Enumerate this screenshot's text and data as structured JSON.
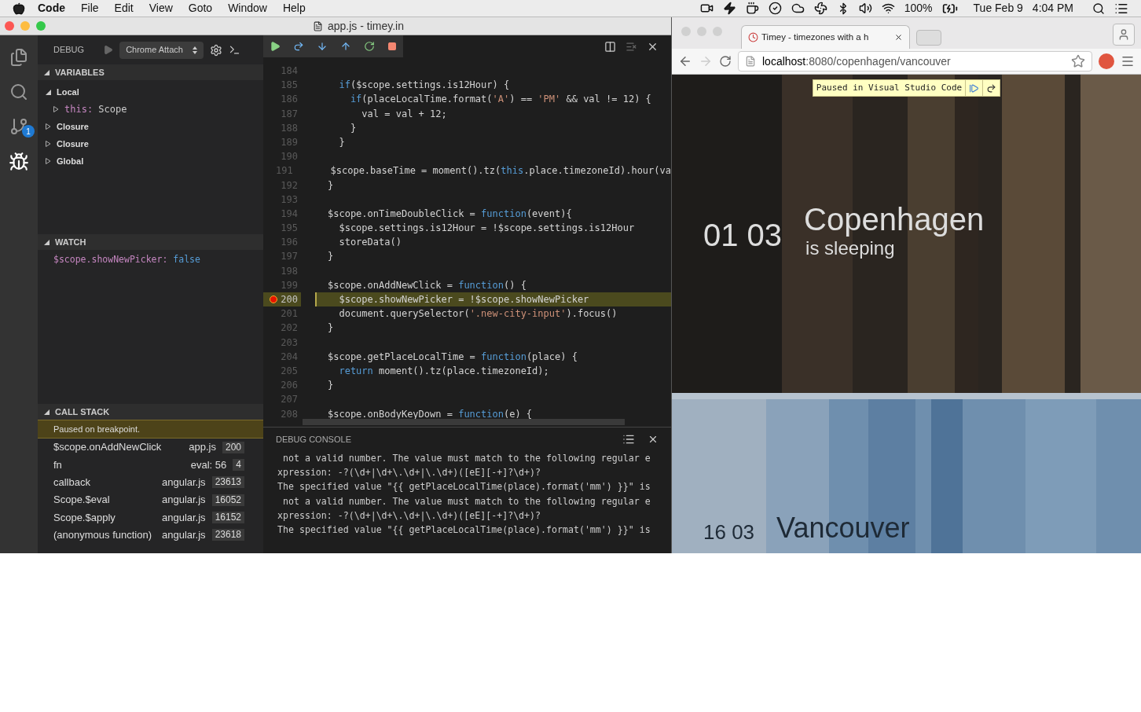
{
  "menubar": {
    "app": "Code",
    "menus": [
      "File",
      "Edit",
      "View",
      "Goto",
      "Window",
      "Help"
    ],
    "battery": "100%",
    "date": "Tue Feb 9",
    "time": "4:04 PM"
  },
  "editor_window": {
    "title": "app.js - timey.in",
    "activity_badge": "1",
    "debug_header": {
      "label": "DEBUG",
      "configuration": "Chrome Attach"
    },
    "variables": {
      "title": "VARIABLES",
      "expanded": true,
      "items": [
        {
          "label": "Local",
          "expanded": true,
          "children": [
            {
              "name": "this:",
              "value": "Scope",
              "expanded": false
            }
          ]
        },
        {
          "label": "Closure",
          "expanded": false
        },
        {
          "label": "Closure",
          "expanded": false
        },
        {
          "label": "Global",
          "expanded": false
        }
      ]
    },
    "watch": {
      "title": "WATCH",
      "expanded": true,
      "items": [
        {
          "expression": "$scope.showNewPicker:",
          "value": "false"
        }
      ]
    },
    "call_stack": {
      "title": "CALL STACK",
      "expanded": true,
      "status": "Paused on breakpoint.",
      "frames": [
        {
          "name": "$scope.onAddNewClick",
          "source": "app.js",
          "line": "200"
        },
        {
          "name": "fn",
          "source": "eval: 56",
          "line": "4"
        },
        {
          "name": "callback",
          "source": "angular.js",
          "line": "23613"
        },
        {
          "name": "Scope.$eval",
          "source": "angular.js",
          "line": "16052"
        },
        {
          "name": "Scope.$apply",
          "source": "angular.js",
          "line": "16152"
        },
        {
          "name": "(anonymous function)",
          "source": "angular.js",
          "line": "23618"
        }
      ]
    },
    "code": {
      "lines": [
        {
          "number": "184",
          "current": false,
          "breakpoint": false
        },
        {
          "number": "185",
          "current": false,
          "breakpoint": false,
          "tokens": [
            {
              "text": "  if",
              "kind": "keyword"
            },
            {
              "text": "($scope.settings.is12Hour) {",
              "kind": "plain"
            }
          ]
        },
        {
          "number": "186",
          "current": false,
          "breakpoint": false,
          "tokens": [
            {
              "text": "    if",
              "kind": "keyword"
            },
            {
              "text": "(placeLocalTime.format(",
              "kind": "plain"
            },
            {
              "text": "'A'",
              "kind": "string"
            },
            {
              "text": ") == ",
              "kind": "plain"
            },
            {
              "text": "'PM'",
              "kind": "string"
            },
            {
              "text": " && val != 12) {",
              "kind": "plain"
            }
          ]
        },
        {
          "number": "187",
          "current": false,
          "breakpoint": false,
          "tokens": [
            {
              "text": "      val = val + 12;",
              "kind": "plain"
            }
          ]
        },
        {
          "number": "188",
          "current": false,
          "breakpoint": false,
          "tokens": [
            {
              "text": "    }",
              "kind": "plain"
            }
          ]
        },
        {
          "number": "189",
          "current": false,
          "breakpoint": false,
          "tokens": [
            {
              "text": "  }",
              "kind": "plain"
            }
          ]
        },
        {
          "number": "190",
          "current": false,
          "breakpoint": false
        },
        {
          "number": "191",
          "current": false,
          "breakpoint": false,
          "tokens": [
            {
              "text": "  $scope.baseTime = moment().tz(",
              "kind": "plain"
            },
            {
              "text": "this",
              "kind": "keyword"
            },
            {
              "text": ".place.timezoneId).hour(va",
              "kind": "plain"
            }
          ]
        },
        {
          "number": "192",
          "current": false,
          "breakpoint": false,
          "tokens": [
            {
              "text": "}",
              "kind": "plain"
            }
          ]
        },
        {
          "number": "193",
          "current": false,
          "breakpoint": false
        },
        {
          "number": "194",
          "current": false,
          "breakpoint": false,
          "tokens": [
            {
              "text": "$scope.onTimeDoubleClick = ",
              "kind": "plain"
            },
            {
              "text": "function",
              "kind": "keyword"
            },
            {
              "text": "(event){",
              "kind": "plain"
            }
          ]
        },
        {
          "number": "195",
          "current": false,
          "breakpoint": false,
          "tokens": [
            {
              "text": "  $scope.settings.is12Hour = !$scope.settings.is12Hour",
              "kind": "plain"
            }
          ]
        },
        {
          "number": "196",
          "current": false,
          "breakpoint": false,
          "tokens": [
            {
              "text": "  storeData()",
              "kind": "plain"
            }
          ]
        },
        {
          "number": "197",
          "current": false,
          "breakpoint": false,
          "tokens": [
            {
              "text": "}",
              "kind": "plain"
            }
          ]
        },
        {
          "number": "198",
          "current": false,
          "breakpoint": false
        },
        {
          "number": "199",
          "current": false,
          "breakpoint": false,
          "tokens": [
            {
              "text": "$scope.onAddNewClick = ",
              "kind": "plain"
            },
            {
              "text": "function",
              "kind": "keyword"
            },
            {
              "text": "() {",
              "kind": "plain"
            }
          ]
        },
        {
          "number": "200",
          "current": true,
          "breakpoint": true,
          "tokens": [
            {
              "text": "  $scope.showNewPicker = !$scope.showNewPicker",
              "kind": "plain"
            }
          ]
        },
        {
          "number": "201",
          "current": false,
          "breakpoint": false,
          "tokens": [
            {
              "text": "  document.querySelector(",
              "kind": "plain"
            },
            {
              "text": "'.new-city-input'",
              "kind": "string"
            },
            {
              "text": ").focus()",
              "kind": "plain"
            }
          ]
        },
        {
          "number": "202",
          "current": false,
          "breakpoint": false,
          "tokens": [
            {
              "text": "}",
              "kind": "plain"
            }
          ]
        },
        {
          "number": "203",
          "current": false,
          "breakpoint": false
        },
        {
          "number": "204",
          "current": false,
          "breakpoint": false,
          "tokens": [
            {
              "text": "$scope.getPlaceLocalTime = ",
              "kind": "plain"
            },
            {
              "text": "function",
              "kind": "keyword"
            },
            {
              "text": "(place) {",
              "kind": "plain"
            }
          ]
        },
        {
          "number": "205",
          "current": false,
          "breakpoint": false,
          "tokens": [
            {
              "text": "  return",
              "kind": "keyword"
            },
            {
              "text": " moment().tz(place.timezoneId);",
              "kind": "plain"
            }
          ]
        },
        {
          "number": "206",
          "current": false,
          "breakpoint": false,
          "tokens": [
            {
              "text": "}",
              "kind": "plain"
            }
          ]
        },
        {
          "number": "207",
          "current": false,
          "breakpoint": false
        },
        {
          "number": "208",
          "current": false,
          "breakpoint": false,
          "tokens": [
            {
              "text": "$scope.onBodyKeyDown = ",
              "kind": "plain"
            },
            {
              "text": "function",
              "kind": "keyword"
            },
            {
              "text": "(e) {",
              "kind": "plain"
            }
          ]
        }
      ]
    },
    "debug_console": {
      "title": "DEBUG CONSOLE",
      "lines": [
        " not a valid number. The value must match to the following regular e",
        "xpression: -?(\\d+|\\d+\\.\\d+|\\.\\d+)([eE][-+]?\\d+)?",
        "The specified value \"{{ getPlaceLocalTime(place).format('mm') }}\" is",
        " not a valid number. The value must match to the following regular e",
        "xpression: -?(\\d+|\\d+\\.\\d+|\\.\\d+)([eE][-+]?\\d+)?",
        "The specified value \"{{ getPlaceLocalTime(place).format('mm') }}\" is"
      ]
    }
  },
  "browser": {
    "tab": {
      "title": "Timey - timezones with a h"
    },
    "address": {
      "host": "localhost",
      "path": ":8080/copenhagen/vancouver"
    },
    "paused_banner": "Paused in Visual Studio Code",
    "places": [
      {
        "time": "01 03",
        "city": "Copenhagen",
        "status": "is sleeping"
      },
      {
        "time": "16 03",
        "city": "Vancouver"
      }
    ]
  }
}
